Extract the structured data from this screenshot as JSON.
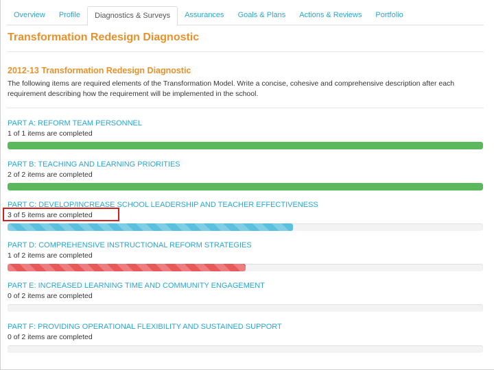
{
  "tabs": [
    {
      "label": "Overview",
      "active": false
    },
    {
      "label": "Profile",
      "active": false
    },
    {
      "label": "Diagnostics & Surveys",
      "active": true
    },
    {
      "label": "Assurances",
      "active": false
    },
    {
      "label": "Goals & Plans",
      "active": false
    },
    {
      "label": "Actions & Reviews",
      "active": false
    },
    {
      "label": "Portfolio",
      "active": false
    }
  ],
  "page_title": "Transformation Redesign Diagnostic",
  "section": {
    "title": "2012-13 Transformation Redesign Diagnostic",
    "intro": "The following items are required elements of the Transformation Model. Write a concise, cohesive and comprehensive description after each requirement describing how the requirement will be implemented in the school."
  },
  "parts": [
    {
      "title": "PART A: REFORM TEAM PERSONNEL",
      "status": "1 of 1 items are completed",
      "completed": 1,
      "total": 1,
      "bar_color": "#5cb85c",
      "striped": false
    },
    {
      "title": "PART B: TEACHING AND LEARNING PRIORITIES",
      "status": "2 of 2 items are completed",
      "completed": 2,
      "total": 2,
      "bar_color": "#5cb85c",
      "striped": false
    },
    {
      "title": "PART C: DEVELOP/INCREASE SCHOOL LEADERSHIP AND TEACHER EFFECTIVENESS",
      "status": "3 of 5 items are completed",
      "completed": 3,
      "total": 5,
      "bar_color": "#5bc0de",
      "striped": true
    },
    {
      "title": "PART D: COMPREHENSIVE INSTRUCTIONAL REFORM STRATEGIES",
      "status": "1 of 2 items are completed",
      "completed": 1,
      "total": 2,
      "bar_color": "#e8595a",
      "striped": true
    },
    {
      "title": "PART E: INCREASED LEARNING TIME AND COMMUNITY ENGAGEMENT",
      "status": "0 of 2 items are completed",
      "completed": 0,
      "total": 2,
      "bar_color": "#f3f3f3",
      "striped": false
    },
    {
      "title": "PART F: PROVIDING OPERATIONAL FLEXIBILITY AND SUSTAINED SUPPORT",
      "status": "0 of 2 items are completed",
      "completed": 0,
      "total": 2,
      "bar_color": "#f3f3f3",
      "striped": false
    }
  ],
  "colors": {
    "accent_orange": "#e8912a",
    "link_blue": "#2aa5cf",
    "highlight_red": "#d11f1f"
  }
}
